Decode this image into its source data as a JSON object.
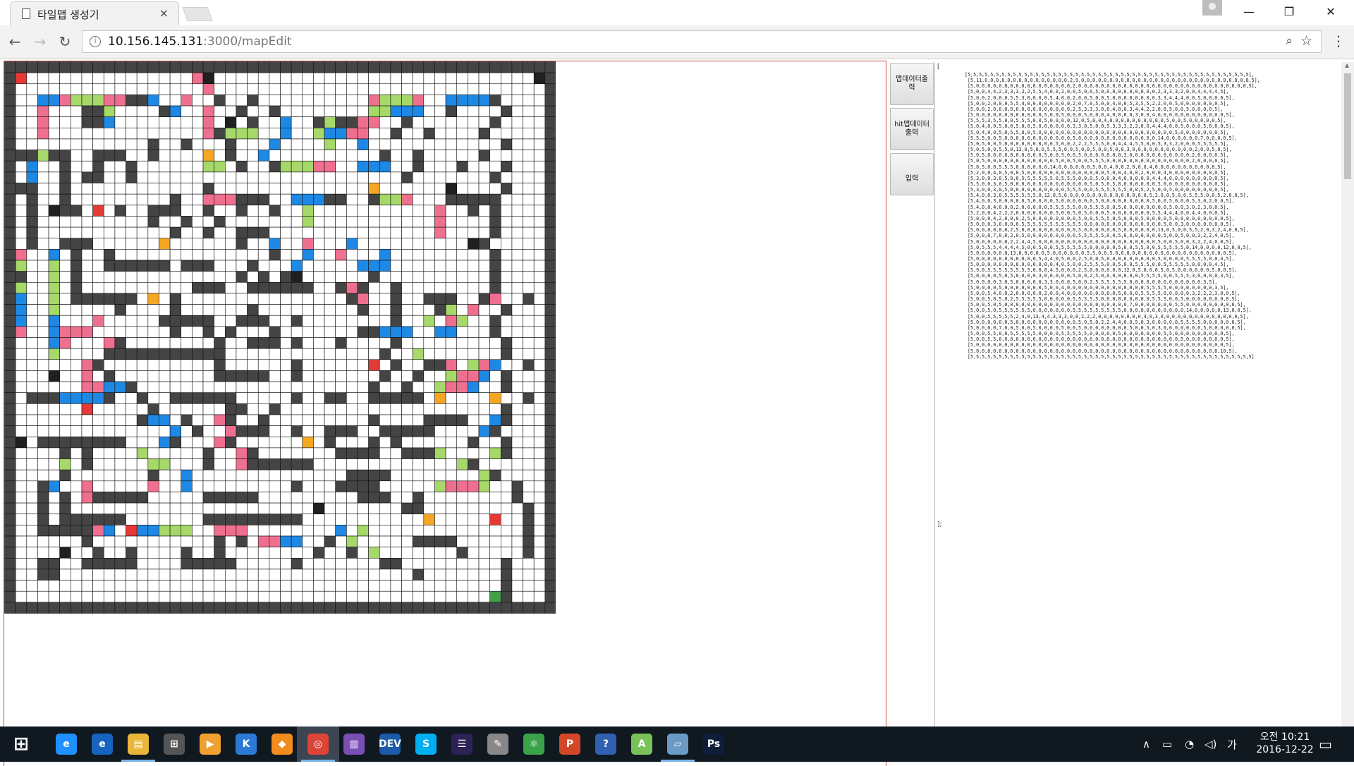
{
  "tab": {
    "title": "타일맵 생성기",
    "close": "×"
  },
  "window": {
    "minimize": "—",
    "maximize": "❐",
    "close": "✕"
  },
  "nav": {
    "back": "←",
    "forward": "→",
    "reload": "↻",
    "info": "i",
    "zoom": "⌕",
    "star": "☆",
    "menu": "⋮"
  },
  "address": {
    "host": "10.156.145.131",
    "rest": ":3000/mapEdit"
  },
  "buttons": {
    "map_out": "맵데이터출력",
    "hit_out": "hit맵데이터출력",
    "input": "입력"
  },
  "textarea": {
    "open": "[",
    "close": "];"
  },
  "taskbar": {
    "start": "⊞",
    "apps": [
      {
        "name": "ie-icon",
        "label": "e",
        "color": "#1e90ff",
        "running": false
      },
      {
        "name": "edge-icon",
        "label": "e",
        "color": "#1565c0",
        "running": false
      },
      {
        "name": "file-explorer-icon",
        "label": "▤",
        "color": "#e8b73a",
        "running": true
      },
      {
        "name": "store-icon",
        "label": "⊞",
        "color": "#555",
        "running": false
      },
      {
        "name": "media-icon",
        "label": "▶",
        "color": "#f0a030",
        "running": false
      },
      {
        "name": "vs-code-icon",
        "label": "K",
        "color": "#2a7ad6",
        "running": false
      },
      {
        "name": "sublime-icon",
        "label": "◆",
        "color": "#f28c1e",
        "running": false
      },
      {
        "name": "chrome-icon",
        "label": "◎",
        "color": "#db4437",
        "running": true
      },
      {
        "name": "visual-studio-icon",
        "label": "▥",
        "color": "#7a4fb5",
        "running": false
      },
      {
        "name": "dev-cpp-icon",
        "label": "DEV",
        "color": "#1a5aa8",
        "running": false
      },
      {
        "name": "skype-icon",
        "label": "S",
        "color": "#00aff0",
        "running": false
      },
      {
        "name": "eclipse-icon",
        "label": "☰",
        "color": "#2c2255",
        "running": false
      },
      {
        "name": "paint-icon",
        "label": "✎",
        "color": "#888",
        "running": false
      },
      {
        "name": "atom-icon",
        "label": "⚛",
        "color": "#3aa34a",
        "running": false
      },
      {
        "name": "powerpoint-icon",
        "label": "P",
        "color": "#d24726",
        "running": false
      },
      {
        "name": "hwp-icon",
        "label": "?",
        "color": "#3060b0",
        "running": false
      },
      {
        "name": "android-icon",
        "label": "A",
        "color": "#78c257",
        "running": false
      },
      {
        "name": "notepad-icon",
        "label": "▱",
        "color": "#6b9ac4",
        "running": true
      },
      {
        "name": "photoshop-icon",
        "label": "Ps",
        "color": "#0e1e3a",
        "running": false
      }
    ],
    "tray": {
      "chevron": "∧",
      "ime": "가",
      "time": "오전 10:21",
      "date": "2016-12-22",
      "notify": "▭"
    }
  },
  "map_text_lines": [
    "[5,5,5,5,5,5,5,5,5,5,5,5,5,5,5,5,5,5,5,5,5,5,5,5,5,5,5,5,5,5,5,5,5,5,5,5,5,5,5,5,5,5,5,5,5,5,5,5,5,5],",
    " [5,11,0,0,0,0,0,0,0,0,0,0,0,0,0,0,0,2,9,0,0,0,0,0,0,0,0,0,0,0,0,0,0,0,0,0,0,0,0,0,0,0,0,0,0,0,0,0,8,5],",
    " [5,0,0,0,0,0,0,0,0,0,0,0,0,0,0,0,0,0,2,0,0,0,0,0,0,0,0,0,0,0,0,0,0,0,0,0,0,0,0,0,0,0,0,0,0,0,0,0,0,5],",
    " [5,0,0,4,4,2,3,3,3,2,2,5,5,4,0,0,2,0,0,5,0,0,5,0,0,0,0,0,0,0,0,0,0,2,3,3,3,2,0,0,4,4,4,4,5],",
    " [5,0,0,2,0,0,0,5,5,3,0,0,0,0,5,4,0,0,2,0,0,5,0,0,5,0,0,0,0,0,0,0,0,3,3,4,4,4,0,0,5,0,0,0,0,5],",
    " [5,0,0,2,0,0,0,5,5,4,0,0,0,0,0,0,0,0,2,0,7,0,5,0,0,4,0,0,5,3,5,5,2,2,0,0,5,0,0,0,0,0,0,0,5],",
    " [5,0,0,2,0,0,0,0,0,0,0,0,0,0,0,0,0,0,2,5,3,3,3,0,0,4,0,0,3,4,4,2,2,0,0,5,0,0,5,0,0,0,0,5],",
    " [5,0,0,0,0,0,0,0,0,0,0,0,0,5,0,0,5,0,0,0,5,0,0,0,4,0,0,0,0,3,0,0,4,0,0,0,0,0,0,0,0,0,0,0,0,5],",
    " [5,5,5,3,5,5,0,0,5,5,5,0,0,5,0,0,0,0,12,0,5,0,0,4,0,0,0,0,0,0,0,0,0,0,5,0,0,5,0,0,0,0,0,5],",
    " [5,0,4,0,0,5,0,0,5,0,0,5,0,0,0,0,0,0,3,3,0,5,0,0,5,3,3,3,2,2,0,0,4,4,4,0,0,5,0,0,0,5,0,0,0,5],",
    " [5,0,4,0,0,5,0,5,5,0,0,5,0,0,0,0,0,0,0,0,0,0,0,0,0,0,0,0,0,0,0,0,0,0,0,0,5,0,0,0,0,0,0,0,5],",
    " [5,5,5,0,0,5,0,0,0,0,0,0,0,0,0,0,0,0,5,0,0,0,0,0,0,0,0,0,0,0,0,0,0,14,0,0,0,0,0,0,7,0,0,0,0,5],",
    " [5,0,5,0,0,5,0,0,0,0,0,0,0,0,0,5,0,0,2,2,2,5,5,5,0,0,4,4,4,5,5,0,0,5,3,3,2,0,0,0,5,5,5,5,5],",
    " [5,0,5,0,9,5,5,0,13,0,5,0,0,5,5,5,0,0,5,0,0,5,0,0,5,0,0,3,0,0,0,0,0,0,0,0,0,0,0,2,0,0,5,0,5],",
    " [5,0,5,0,0,0,0,0,0,0,0,0,0,5,0,0,5,0,0,5,0,0,0,0,0,0,0,3,0,0,0,0,0,0,0,0,0,0,0,2,0,0,0,0,5],",
    " [5,0,5,0,0,0,0,0,0,0,0,0,0,0,0,5,0,0,5,0,0,5,5,5,0,0,0,0,0,0,0,0,0,0,0,0,0,0,0,2,0,0,0,0,5],",
    " [5,0,5,0,0,5,5,5,0,0,0,0,0,0,14,0,0,0,0,0,0,5,0,0,4,0,0,2,0,0,0,4,0,0,0,0,0,0,0,0,0,0,8,5],",
    " [5,2,0,0,4,0,5,0,0,5,0,0,0,0,0,0,0,0,0,0,0,0,0,0,5,0,0,4,0,0,2,0,0,0,4,0,0,0,0,0,0,0,0,0,5],",
    " [5,3,0,0,3,0,5,0,0,5,5,5,5,5,5,0,5,5,5,0,0,0,5,0,0,0,4,0,0,0,0,0,4,4,4,0,0,0,0,0,0,0,0,0,5],",
    " [5,5,0,0,3,0,5,0,0,0,0,0,0,0,0,0,0,0,0,0,0,5,0,5,0,5,8,0,0,0,0,0,0,5,0,0,0,0,0,0,0,0,0,0,5],",
    " [5,3,0,0,3,0,5,0,0,0,0,0,0,0,0,0,0,5,5,5,0,0,5,5,5,5,5,5,0,0,5,2,5,0,0,5,0,0,0,0,0,0,0,0,5],",
    " [5,4,0,0,3,0,5,5,5,5,5,5,0,12,0,5,0,0,0,0,0,0,0,0,0,0,0,0,0,0,0,5,2,0,0,5,0,0,5,5,5,0,0,5,2,0,0,5],",
    " [5,4,0,0,3,0,0,0,0,0,5,0,0,0,0,5,0,0,0,0,0,0,5,0,0,0,0,0,0,0,0,0,5,0,0,5,0,0,0,5,3,0,2,0,0,5],",
    " [5,4,0,0,4,0,0,0,2,0,0,0,0,0,5,5,5,5,5,0,0,5,5,5,0,0,5,0,0,0,0,0,0,0,0,5,0,0,3,0,2,3,0,0,5],",
    " [5,2,0,0,4,2,2,2,0,0,0,0,0,0,0,5,0,0,5,0,5,0,0,0,5,0,0,0,0,0,0,0,5,5,4,4,4,0,0,4,4,0,0,0,5],",
    " [5,0,0,0,4,2,0,0,0,2,5,0,0,0,0,0,0,0,0,5,0,0,5,5,5,0,5,0,0,0,5,0,0,0,0,5,0,0,0,0,0,0,0,0,0,5],",
    " [5,0,0,0,3,0,0,0,0,5,5,5,5,5,5,5,5,5,5,5,0,0,0,0,0,0,0,0,0,0,0,0,0,0,5,0,0,3,0,0,0,0,0,0,0,5],",
    " [5,0,0,0,0,0,0,2,5,0,0,0,0,0,0,0,0,0,0,5,0,0,0,0,0,0,5,0,0,0,0,0,0,13,0,5,0,0,5,5,2,0,3,2,4,0,0,5],",
    " [5,0,0,0,7,0,0,2,0,5,0,0,0,0,0,0,0,0,0,5,5,5,5,5,0,0,5,0,0,0,0,0,0,0,5,0,0,5,0,0,3,2,2,4,0,5],",
    " [5,0,0,0,0,0,0,2,2,4,4,5,0,0,0,0,0,0,0,0,0,0,0,0,0,0,0,0,0,0,0,0,0,5,0,0,5,0,0,3,2,2,4,0,0,5],",
    " [5,0,5,5,5,4,4,4,4,5,0,0,5,0,0,5,5,5,5,5,5,0,0,0,0,0,5,0,0,5,5,0,0,5,5,5,5,5,0,14,0,0,0,0,12,0,0,5],",
    " [5,0,0,0,0,0,0,13,0,0,0,0,0,5,0,0,0,0,0,0,5,5,0,0,5,0,0,0,0,0,0,0,0,0,0,0,0,0,0,0,0,0,0,0,0,5],",
    " [5,0,0,0,0,0,0,0,0,0,0,0,5,4,4,0,5,0,0,2,5,0,0,5,0,0,0,0,0,0,0,0,0,5,0,0,0,0,5,5,5,5,0,0,4,5],",
    " [5,0,0,0,0,0,0,0,0,0,0,0,0,0,0,4,0,5,0,0,2,5,5,5,0,0,5,0,0,5,5,5,0,0,5,5,5,5,5,0,0,0,0,4,5],",
    " [5,9,0,5,5,5,5,5,5,5,5,0,0,0,4,5,0,0,0,2,5,0,0,0,0,0,0,12,0,5,0,0,0,5,0,5,0,0,0,0,0,0,5,0,0,5],",
    " [5,0,0,0,0,5,0,5,0,0,0,0,3,0,0,0,0,0,5,0,0,2,5,0,0,0,0,0,0,0,5,5,5,5,0,0,5,5,5,3,0,0,0,0,3,5],",
    " [5,0,0,0,0,3,0,5,0,0,0,0,0,3,3,0,0,0,5,0,0,2,5,5,5,5,5,5,0,0,0,0,0,0,0,0,0,0,0,0,0,3,5],",
    " [5,0,0,0,0,5,0,0,0,0,0,0,0,5,0,0,4,0,0,0,0,0,0,0,0,0,0,0,0,0,0,5,5,5,5,0,0,0,0,0,0,0,0,3,5],",
    " [5,0,0,5,4,0,0,2,0,0,0,0,0,2,0,0,4,0,0,0,0,0,0,0,0,0,5,0,0,0,5,5,5,5,0,0,0,0,0,3,2,2,2,3,0,0,5],",
    " [5,0,0,5,0,5,0,2,5,5,5,5,5,0,0,0,0,0,5,5,5,5,5,0,0,0,0,0,0,0,0,0,5,5,5,0,0,5,0,0,0,0,0,0,0,0,5],",
    " [5,0,0,5,0,5,0,0,0,0,0,0,0,0,0,0,0,0,0,0,0,0,0,0,0,0,0,0,7,0,0,0,0,0,0,0,5,5,0,0,0,0,0,0,0,0,0,5],",
    " [5,0,0,5,0,5,5,5,5,5,5,0,0,0,0,0,0,0,5,5,5,5,5,5,5,5,5,0,0,0,0,0,0,0,0,0,0,0,14,0,0,0,0,0,13,0,0,5],",
    " [5,0,0,5,5,5,5,5,2,4,0,13,4,4,3,3,3,0,0,2,2,2,0,0,0,0,0,0,0,0,4,0,3,0,0,0,0,0,0,0,0,0,0,0,0,0,0,5],",
    " [5,0,0,0,0,0,0,5,0,0,0,0,0,0,0,0,0,0,0,5,0,5,0,2,2,4,4,0,0,5,0,3,0,0,0,0,0,5,5,5,5,0,0,0,0,0,0,5],",
    " [5,0,0,0,0,7,0,0,5,0,0,5,0,0,0,0,5,0,0,5,0,0,0,0,0,0,0,0,5,0,0,5,0,3,0,0,0,0,0,0,0,5,0,0,0,0,0,5],",
    " [5,0,0,5,5,0,0,5,5,5,5,5,0,0,0,0,5,5,5,5,5,0,0,0,0,0,5,0,0,0,0,0,0,0,5,5,0,0,0,0,0,0,0,0,0,5],",
    " [5,0,0,5,5,0,0,0,0,0,0,0,0,0,0,0,0,0,0,0,0,0,0,0,0,0,0,0,0,0,0,0,0,0,0,0,0,5,0,0,0,0,0,0,0,5],",
    " [5,0,0,0,0,0,0,0,0,0,0,0,0,0,0,0,0,0,0,0,0,0,0,0,0,0,0,0,0,0,0,0,0,0,0,0,0,0,0,0,0,0,0,0,0,5],",
    " [5,0,0,0,0,0,0,0,0,0,0,0,0,0,0,0,0,0,0,0,0,0,0,0,0,0,0,0,0,0,0,0,0,0,0,0,0,0,0,0,0,0,0,0,10,5],",
    " [5,5,5,5,5,5,5,5,5,5,5,5,5,5,5,5,5,5,5,5,5,5,5,5,5,5,5,5,5,5,5,5,5,5,5,5,5,5,5,5,5,5,5,5,5,5,5,5,5,5]"
  ],
  "tile_colors": {
    "wall": "#444444",
    "floor": "#ffffff",
    "blue": "#1e88e5",
    "pink": "#ef6f8f",
    "green": "#a6d86a",
    "dark": "#202020",
    "orange": "#f5a623",
    "start": "#e53935",
    "goal": "#43a047"
  }
}
